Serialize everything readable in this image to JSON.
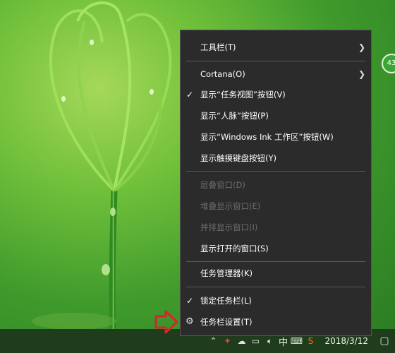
{
  "menu": {
    "items": [
      {
        "label": "工具栏(T)"
      },
      {
        "label": "Cortana(O)"
      },
      {
        "label": "显示“任务视图”按钮(V)"
      },
      {
        "label": "显示“人脉”按钮(P)"
      },
      {
        "label": "显示“Windows Ink 工作区”按钮(W)"
      },
      {
        "label": "显示触摸键盘按钮(Y)"
      },
      {
        "label": "层叠窗口(D)"
      },
      {
        "label": "堆叠显示窗口(E)"
      },
      {
        "label": "并排显示窗口(I)"
      },
      {
        "label": "显示打开的窗口(S)"
      },
      {
        "label": "任务管理器(K)"
      },
      {
        "label": "锁定任务栏(L)"
      },
      {
        "label": "任务栏设置(T)"
      }
    ]
  },
  "taskbar": {
    "ime": "中",
    "date": "2018/3/12"
  },
  "badge": {
    "text": "43"
  },
  "colors": {
    "menu_bg": "#2b2b2b",
    "highlight_border": "#d9232d",
    "arrow": "#d9232d"
  }
}
